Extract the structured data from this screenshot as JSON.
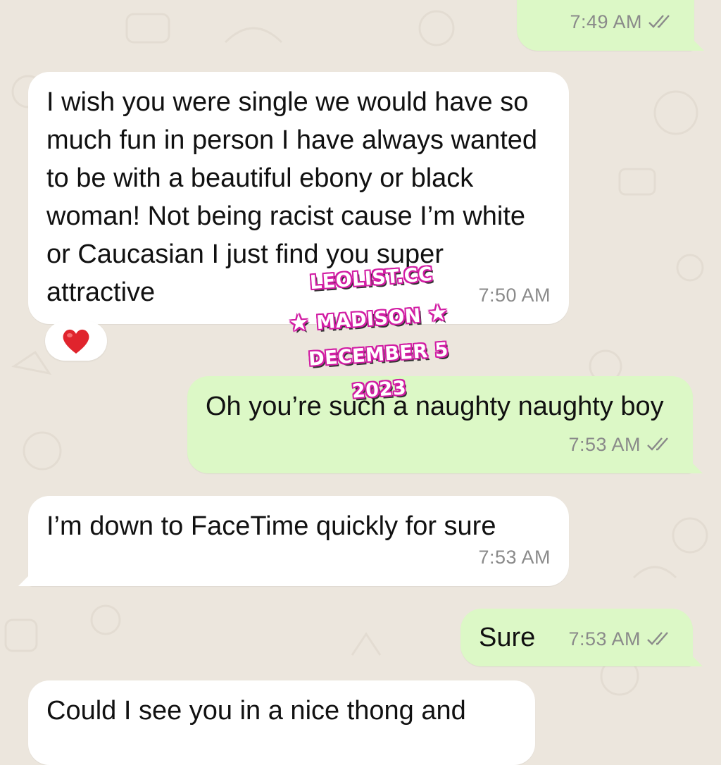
{
  "messages": [
    {
      "dir": "out",
      "text": "",
      "time": "7:49 AM",
      "ticks": "read"
    },
    {
      "dir": "in",
      "text": "I wish you were single we would have so much fun in person I have always wanted to be with a beautiful ebony or black woman! Not being racist cause I’m white or Caucasian I just find you super attractive",
      "time": "7:50 AM",
      "reaction": "heart"
    },
    {
      "dir": "out",
      "text": "Oh you’re such a naughty naughty boy",
      "time": "7:53 AM",
      "ticks": "read"
    },
    {
      "dir": "in",
      "text": "I’m down to FaceTime quickly for sure",
      "time": "7:53 AM"
    },
    {
      "dir": "out",
      "text": "Sure",
      "time": "7:53 AM",
      "ticks": "read"
    },
    {
      "dir": "in",
      "text": "Could I see you in a nice thong and",
      "time": ""
    }
  ],
  "watermark": {
    "line1": "LEOLIST.CC",
    "line2": "MADISON",
    "line3": "DECEMBER 5",
    "line4": "2023"
  },
  "colors": {
    "background": "#ece6dd",
    "incoming_bubble": "#ffffff",
    "outgoing_bubble": "#dcf8c6",
    "read_ticks": "#8a8a8a",
    "watermark_outline": "#d21ea4"
  },
  "icons": {
    "ticks": "double-check-icon",
    "reaction": "red-heart-icon",
    "star": "star-icon"
  }
}
